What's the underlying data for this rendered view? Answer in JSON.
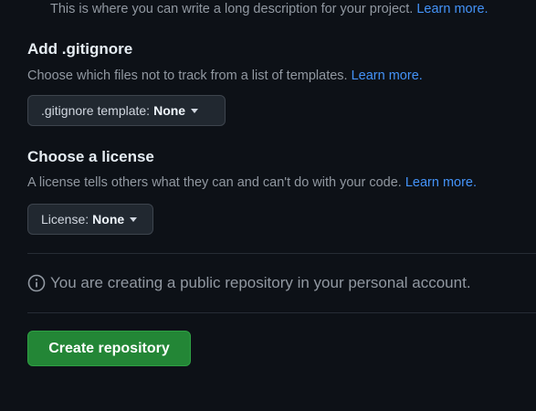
{
  "description": {
    "text": "This is where you can write a long description for your project.",
    "link": "Learn more."
  },
  "gitignore": {
    "title": "Add .gitignore",
    "desc": "Choose which files not to track from a list of templates.",
    "link": "Learn more.",
    "select_label": ".gitignore template:",
    "select_value": "None"
  },
  "license": {
    "title": "Choose a license",
    "desc": "A license tells others what they can and can't do with your code.",
    "link": "Learn more.",
    "select_label": "License:",
    "select_value": "None"
  },
  "notice": {
    "icon": "info-icon",
    "text": "You are creating a public repository in your personal account."
  },
  "create_button": {
    "label": "Create repository",
    "color": "#238636"
  },
  "colors": {
    "background": "#0d1117",
    "link": "#4493f8",
    "muted": "#9198a1"
  }
}
